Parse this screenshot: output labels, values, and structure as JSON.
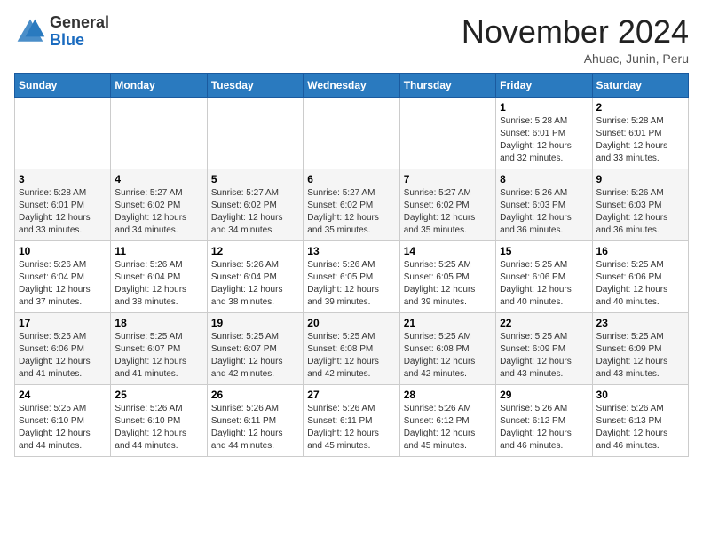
{
  "header": {
    "logo_general": "General",
    "logo_blue": "Blue",
    "month_title": "November 2024",
    "location": "Ahuac, Junin, Peru"
  },
  "calendar": {
    "days_of_week": [
      "Sunday",
      "Monday",
      "Tuesday",
      "Wednesday",
      "Thursday",
      "Friday",
      "Saturday"
    ],
    "weeks": [
      [
        {
          "day": "",
          "info": ""
        },
        {
          "day": "",
          "info": ""
        },
        {
          "day": "",
          "info": ""
        },
        {
          "day": "",
          "info": ""
        },
        {
          "day": "",
          "info": ""
        },
        {
          "day": "1",
          "info": "Sunrise: 5:28 AM\nSunset: 6:01 PM\nDaylight: 12 hours and 32 minutes."
        },
        {
          "day": "2",
          "info": "Sunrise: 5:28 AM\nSunset: 6:01 PM\nDaylight: 12 hours and 33 minutes."
        }
      ],
      [
        {
          "day": "3",
          "info": "Sunrise: 5:28 AM\nSunset: 6:01 PM\nDaylight: 12 hours and 33 minutes."
        },
        {
          "day": "4",
          "info": "Sunrise: 5:27 AM\nSunset: 6:02 PM\nDaylight: 12 hours and 34 minutes."
        },
        {
          "day": "5",
          "info": "Sunrise: 5:27 AM\nSunset: 6:02 PM\nDaylight: 12 hours and 34 minutes."
        },
        {
          "day": "6",
          "info": "Sunrise: 5:27 AM\nSunset: 6:02 PM\nDaylight: 12 hours and 35 minutes."
        },
        {
          "day": "7",
          "info": "Sunrise: 5:27 AM\nSunset: 6:02 PM\nDaylight: 12 hours and 35 minutes."
        },
        {
          "day": "8",
          "info": "Sunrise: 5:26 AM\nSunset: 6:03 PM\nDaylight: 12 hours and 36 minutes."
        },
        {
          "day": "9",
          "info": "Sunrise: 5:26 AM\nSunset: 6:03 PM\nDaylight: 12 hours and 36 minutes."
        }
      ],
      [
        {
          "day": "10",
          "info": "Sunrise: 5:26 AM\nSunset: 6:04 PM\nDaylight: 12 hours and 37 minutes."
        },
        {
          "day": "11",
          "info": "Sunrise: 5:26 AM\nSunset: 6:04 PM\nDaylight: 12 hours and 38 minutes."
        },
        {
          "day": "12",
          "info": "Sunrise: 5:26 AM\nSunset: 6:04 PM\nDaylight: 12 hours and 38 minutes."
        },
        {
          "day": "13",
          "info": "Sunrise: 5:26 AM\nSunset: 6:05 PM\nDaylight: 12 hours and 39 minutes."
        },
        {
          "day": "14",
          "info": "Sunrise: 5:25 AM\nSunset: 6:05 PM\nDaylight: 12 hours and 39 minutes."
        },
        {
          "day": "15",
          "info": "Sunrise: 5:25 AM\nSunset: 6:06 PM\nDaylight: 12 hours and 40 minutes."
        },
        {
          "day": "16",
          "info": "Sunrise: 5:25 AM\nSunset: 6:06 PM\nDaylight: 12 hours and 40 minutes."
        }
      ],
      [
        {
          "day": "17",
          "info": "Sunrise: 5:25 AM\nSunset: 6:06 PM\nDaylight: 12 hours and 41 minutes."
        },
        {
          "day": "18",
          "info": "Sunrise: 5:25 AM\nSunset: 6:07 PM\nDaylight: 12 hours and 41 minutes."
        },
        {
          "day": "19",
          "info": "Sunrise: 5:25 AM\nSunset: 6:07 PM\nDaylight: 12 hours and 42 minutes."
        },
        {
          "day": "20",
          "info": "Sunrise: 5:25 AM\nSunset: 6:08 PM\nDaylight: 12 hours and 42 minutes."
        },
        {
          "day": "21",
          "info": "Sunrise: 5:25 AM\nSunset: 6:08 PM\nDaylight: 12 hours and 42 minutes."
        },
        {
          "day": "22",
          "info": "Sunrise: 5:25 AM\nSunset: 6:09 PM\nDaylight: 12 hours and 43 minutes."
        },
        {
          "day": "23",
          "info": "Sunrise: 5:25 AM\nSunset: 6:09 PM\nDaylight: 12 hours and 43 minutes."
        }
      ],
      [
        {
          "day": "24",
          "info": "Sunrise: 5:25 AM\nSunset: 6:10 PM\nDaylight: 12 hours and 44 minutes."
        },
        {
          "day": "25",
          "info": "Sunrise: 5:26 AM\nSunset: 6:10 PM\nDaylight: 12 hours and 44 minutes."
        },
        {
          "day": "26",
          "info": "Sunrise: 5:26 AM\nSunset: 6:11 PM\nDaylight: 12 hours and 44 minutes."
        },
        {
          "day": "27",
          "info": "Sunrise: 5:26 AM\nSunset: 6:11 PM\nDaylight: 12 hours and 45 minutes."
        },
        {
          "day": "28",
          "info": "Sunrise: 5:26 AM\nSunset: 6:12 PM\nDaylight: 12 hours and 45 minutes."
        },
        {
          "day": "29",
          "info": "Sunrise: 5:26 AM\nSunset: 6:12 PM\nDaylight: 12 hours and 46 minutes."
        },
        {
          "day": "30",
          "info": "Sunrise: 5:26 AM\nSunset: 6:13 PM\nDaylight: 12 hours and 46 minutes."
        }
      ]
    ]
  }
}
